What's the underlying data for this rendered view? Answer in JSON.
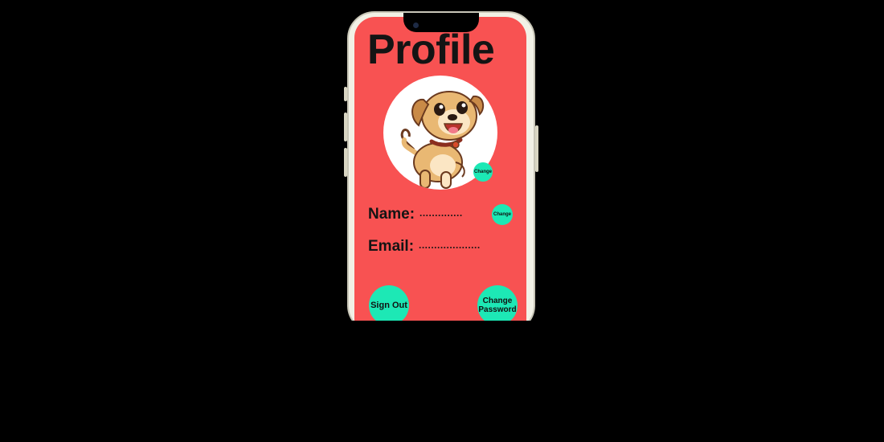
{
  "screen": {
    "title": "Profile",
    "avatar_icon": "puppy-icon",
    "avatar_change_label": "Change",
    "name": {
      "label": "Name:",
      "value": "..............",
      "change_label": "Change"
    },
    "email": {
      "label": "Email:",
      "value": "...................."
    },
    "sign_out_label": "Sign Out",
    "change_password_label": "Change\nPassword"
  },
  "colors": {
    "screen_bg": "#f85252",
    "button": "#1de8b5",
    "text": "#141414",
    "frame": "#f2f1e6"
  }
}
